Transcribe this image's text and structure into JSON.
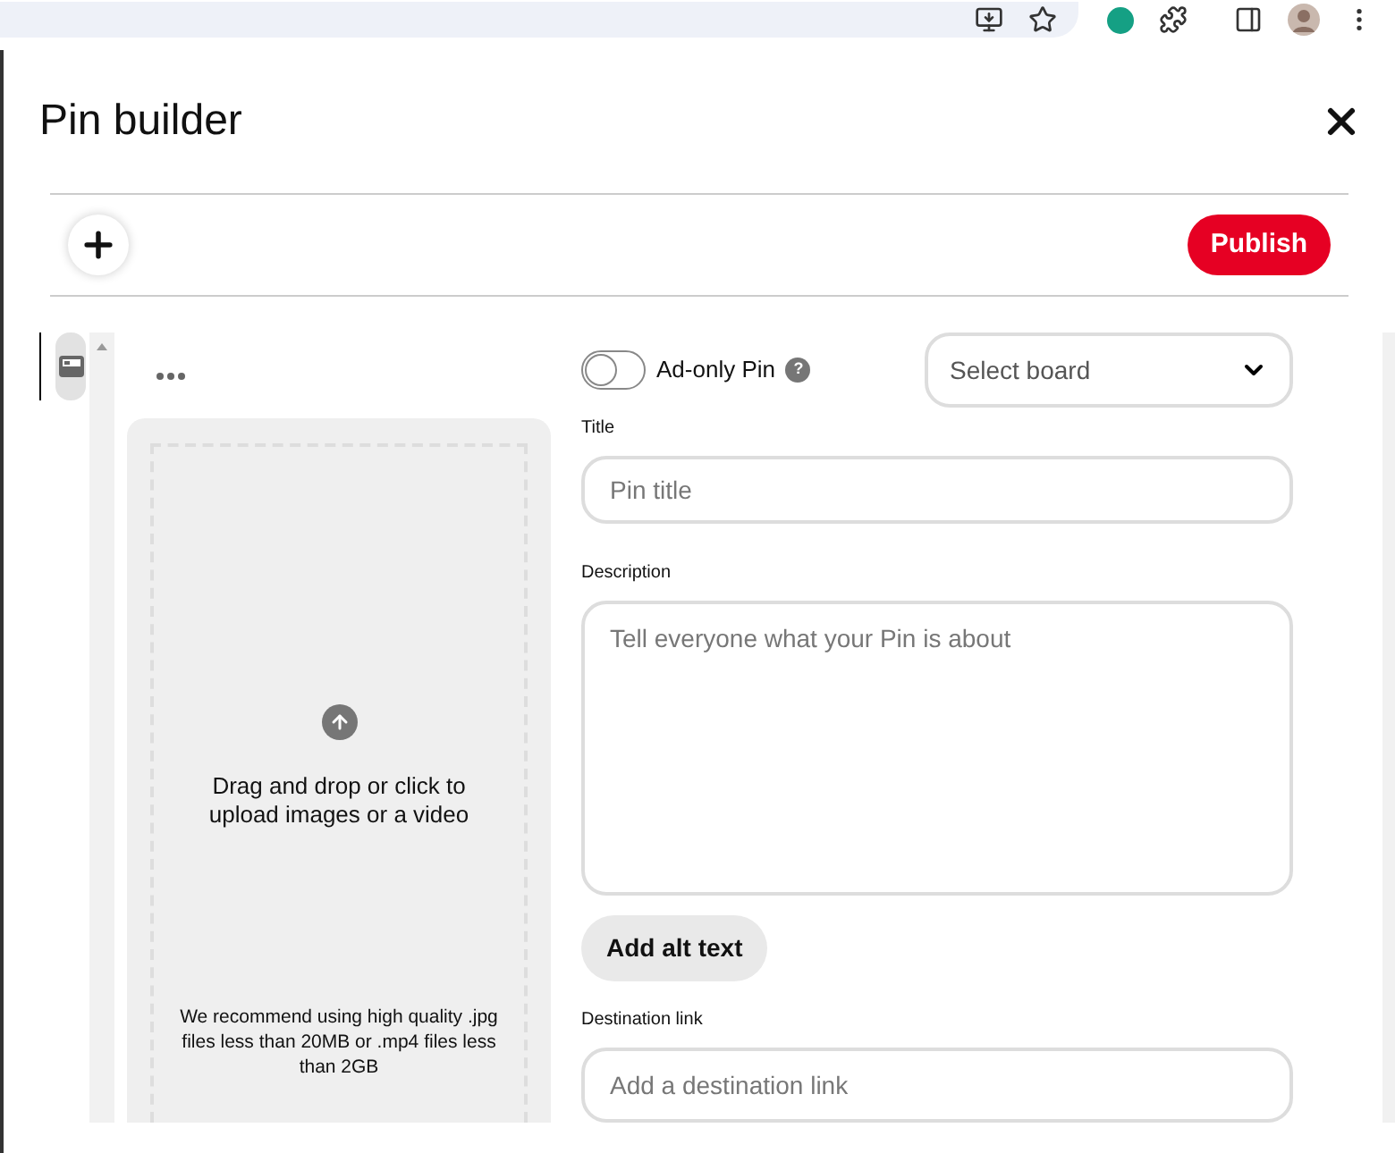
{
  "header": {
    "title": "Pin builder"
  },
  "toolbar": {
    "publish_label": "Publish"
  },
  "rail": {
    "items": [
      {
        "kind": "image",
        "selected": true
      }
    ]
  },
  "upload": {
    "prompt": "Drag and drop or click to upload images or a video",
    "hint": "We recommend using high quality .jpg files less than 20MB or .mp4 files less than 2GB"
  },
  "form": {
    "ad_only": {
      "label": "Ad-only Pin",
      "on": false,
      "help": "?"
    },
    "board": {
      "placeholder": "Select board"
    },
    "title": {
      "label": "Title",
      "placeholder": "Pin title"
    },
    "description": {
      "label": "Description",
      "placeholder": "Tell everyone what your Pin is about"
    },
    "alt_button": "Add alt text",
    "link": {
      "label": "Destination link",
      "placeholder": "Add a destination link"
    }
  }
}
